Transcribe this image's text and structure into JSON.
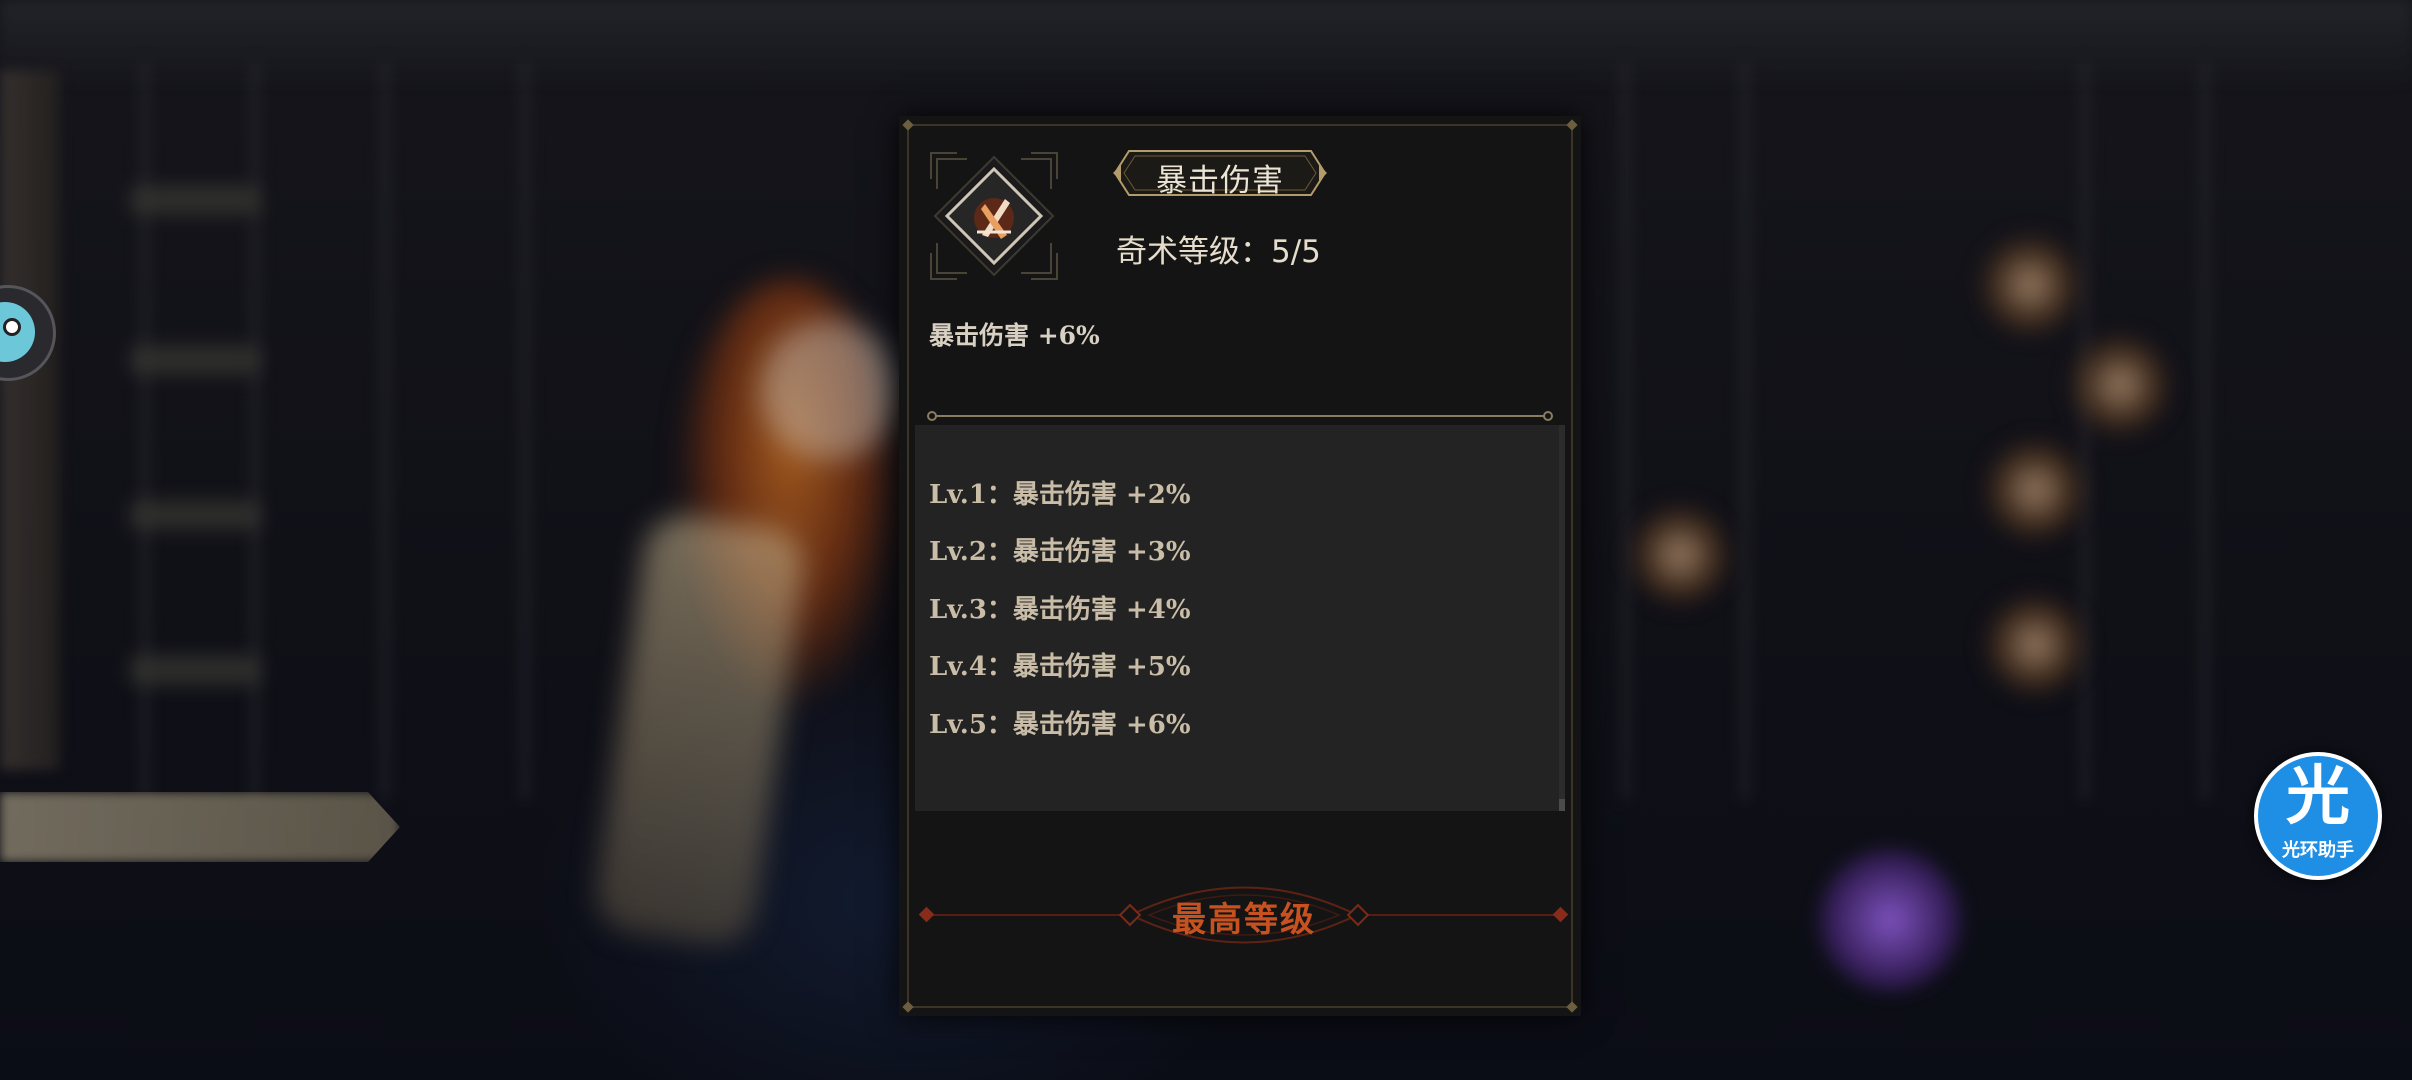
{
  "skill": {
    "name": "暴击伤害",
    "level_text": "奇术等级：5/5",
    "current_effect": "暴击伤害 +6%",
    "icon": "crossed-blades-icon"
  },
  "levels": [
    {
      "label": "Lv.1：暴击伤害 +2%"
    },
    {
      "label": "Lv.2：暴击伤害 +3%"
    },
    {
      "label": "Lv.3：暴击伤害 +4%"
    },
    {
      "label": "Lv.4：暴击伤害 +5%"
    },
    {
      "label": "Lv.5：暴击伤害 +6%"
    }
  ],
  "max_level": {
    "label": "最高等级"
  },
  "assistant": {
    "char": "光",
    "label": "光环助手",
    "icon": "assistant-icon"
  },
  "colors": {
    "panel": "#141414",
    "list_bg": "#232323",
    "accent_orange": "#c8521f",
    "gold_border": "#8a7650",
    "assistant_blue": "#1f8fe6"
  }
}
